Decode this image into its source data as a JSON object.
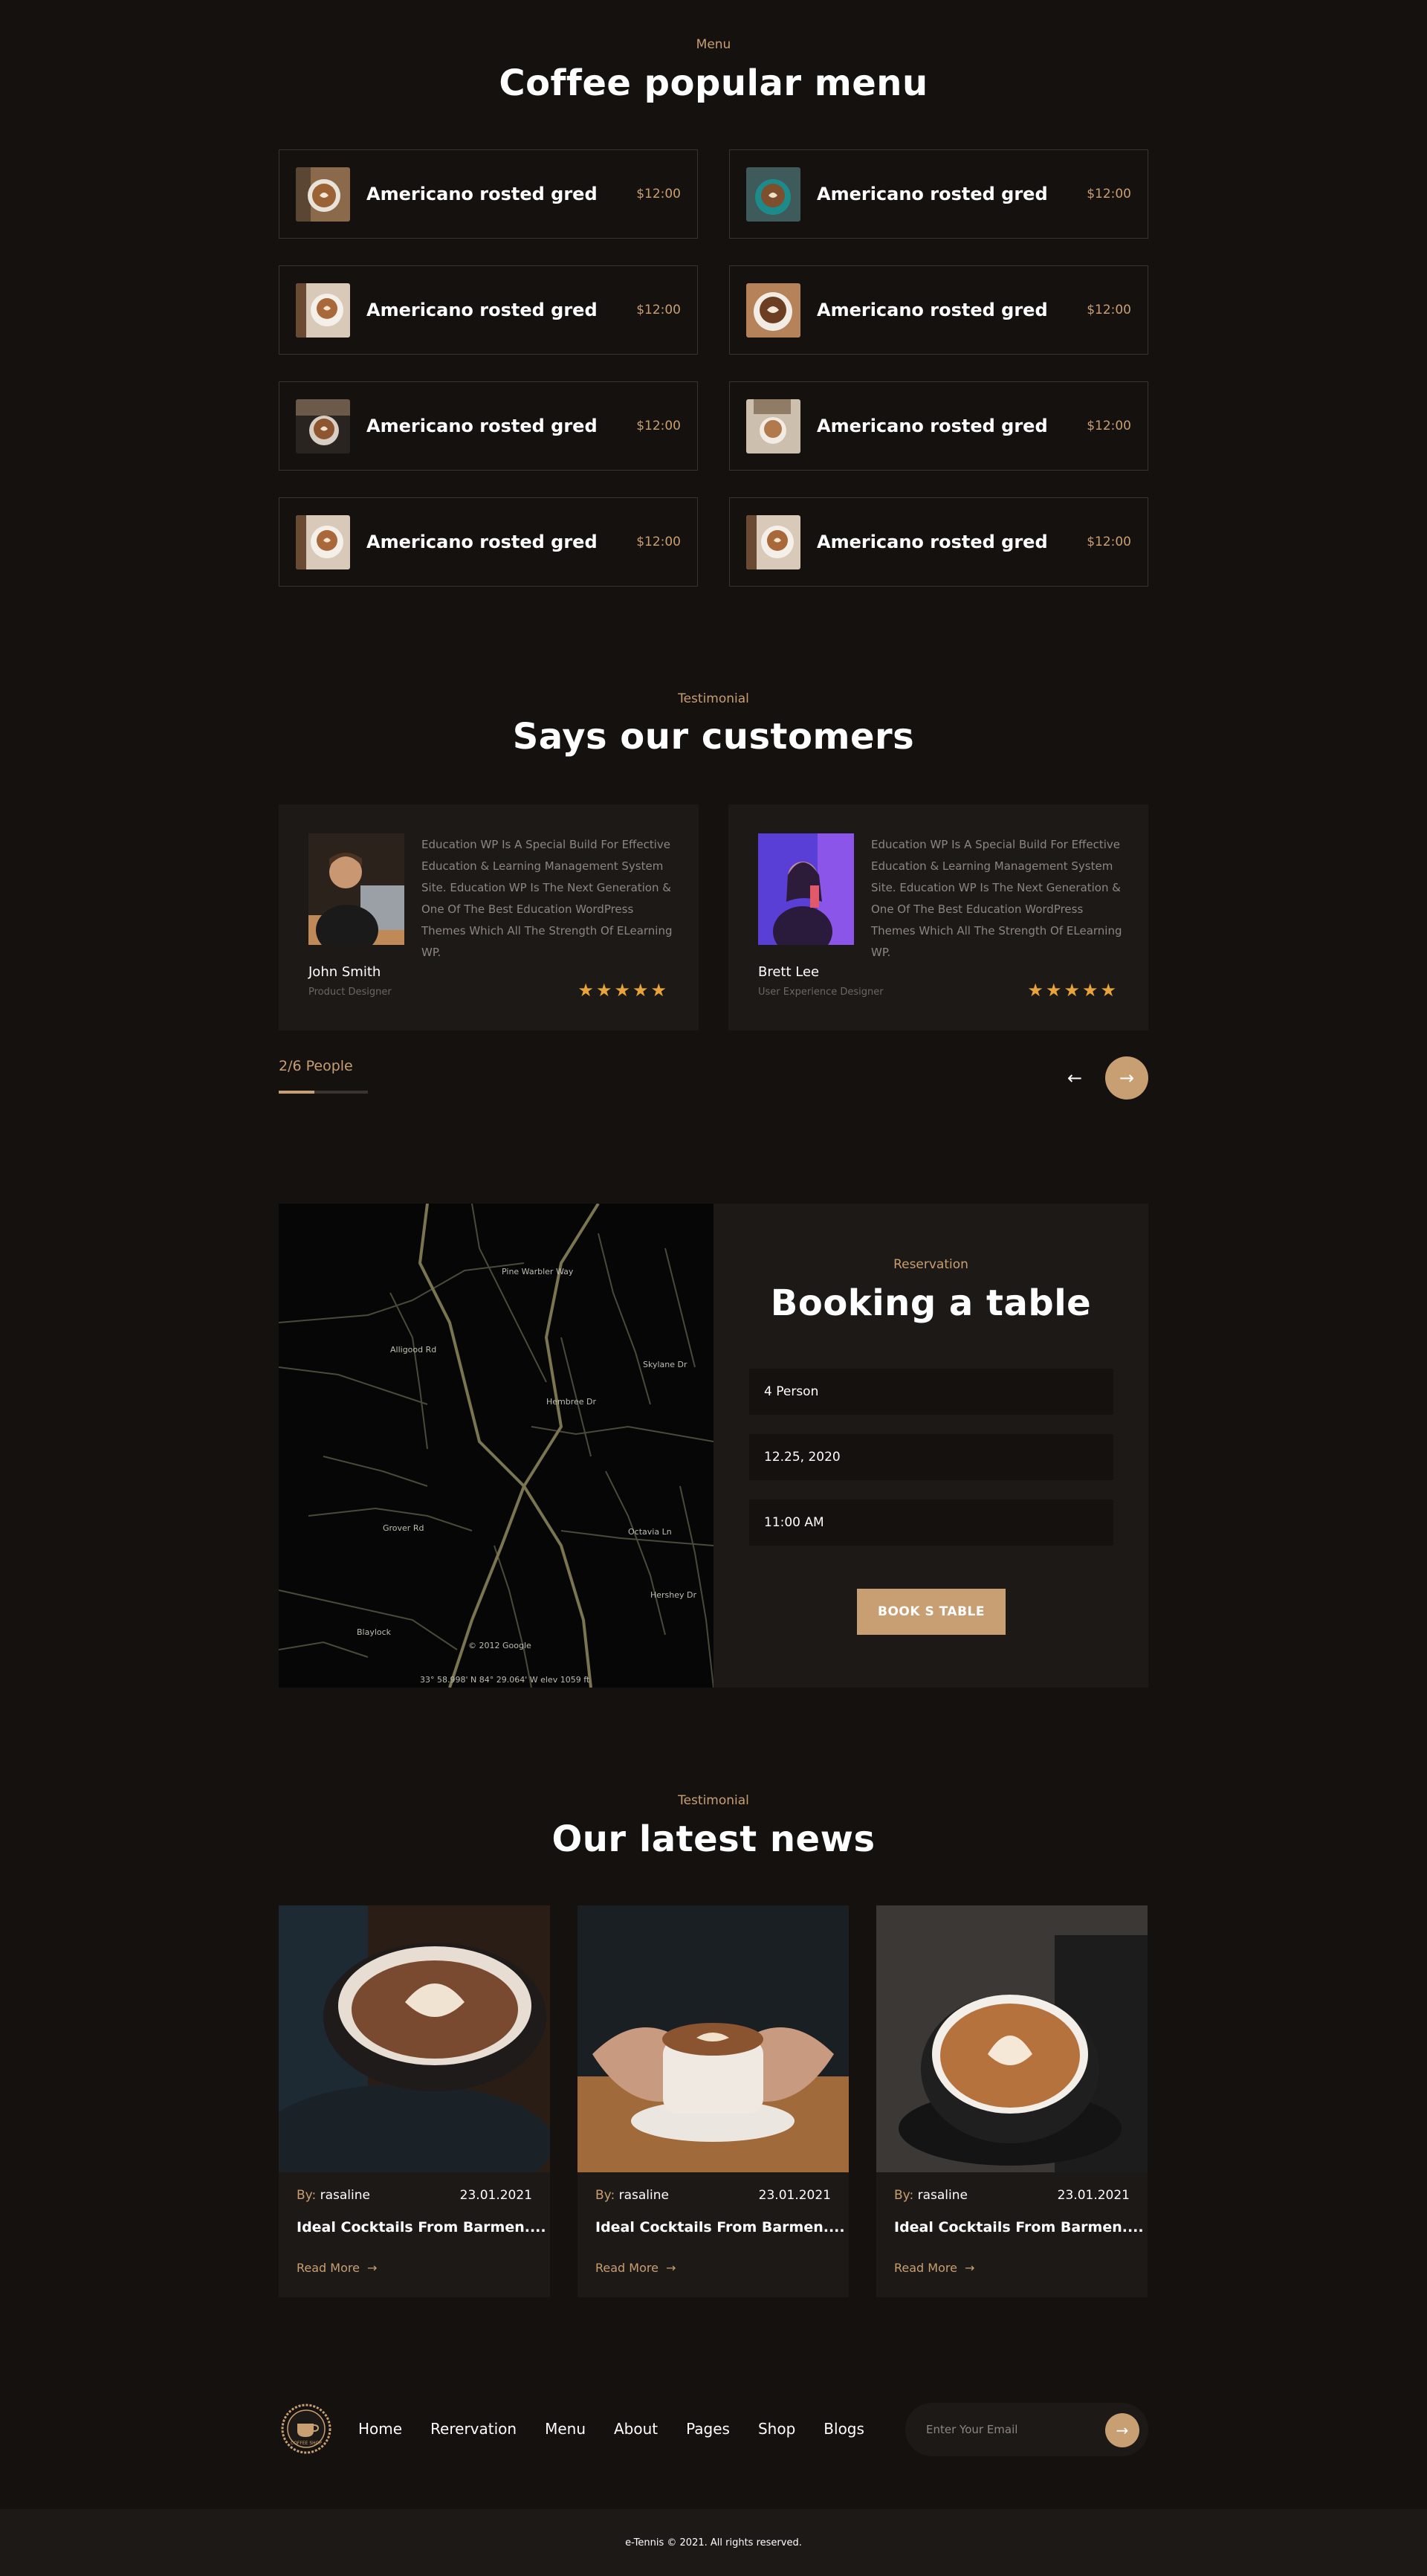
{
  "menu": {
    "eyebrow": "Menu",
    "title": "Coffee popular menu",
    "items": [
      {
        "name": "Americano rosted gred",
        "price": "$12:00"
      },
      {
        "name": "Americano rosted gred",
        "price": "$12:00"
      },
      {
        "name": "Americano rosted gred",
        "price": "$12:00"
      },
      {
        "name": "Americano rosted gred",
        "price": "$12:00"
      },
      {
        "name": "Americano rosted gred",
        "price": "$12:00"
      },
      {
        "name": "Americano rosted gred",
        "price": "$12:00"
      },
      {
        "name": "Americano rosted gred",
        "price": "$12:00"
      },
      {
        "name": "Americano rosted gred",
        "price": "$12:00"
      }
    ]
  },
  "testimonial": {
    "eyebrow": "Testimonial",
    "title": "Says our customers",
    "items": [
      {
        "text": "Education WP Is A Special Build For Effective Education & Learning Management System Site. Education WP Is The Next Generation & One Of The Best Education WordPress Themes Which All The Strength Of ELearning WP.",
        "name": "John Smith",
        "role": "Product Designer",
        "stars": "★★★★★"
      },
      {
        "text": "Education WP Is A Special Build For Effective Education & Learning Management System Site. Education WP Is The Next Generation & One Of The Best Education WordPress Themes Which All The Strength Of ELearning WP.",
        "name": "Brett Lee",
        "role": "User Experience Designer",
        "stars": "★★★★★"
      }
    ],
    "people_count": "2/6 People",
    "prev_icon": "←",
    "next_icon": "→"
  },
  "booking": {
    "eyebrow": "Reservation",
    "title": "Booking a table",
    "person": "4 Person",
    "date": "12.25, 2020",
    "time": "11:00 AM",
    "button": "BOOK S TABLE",
    "map_labels": {
      "street1": "Pine Warbler Way",
      "street2": "Alligood Rd",
      "street3": "Hembree Dr",
      "street4": "Skylane Dr",
      "street5": "Grover Rd",
      "street6": "Octavia Ln",
      "street7": "Blaylock",
      "street8": "Hershey Dr",
      "credit": "© 2012 Google",
      "coords": "33° 58.998' N  84° 29.064' W  elev 1059 ft"
    }
  },
  "news": {
    "eyebrow": "Testimonial",
    "title": "Our latest news",
    "items": [
      {
        "by_label": "By:",
        "author": "rasaline",
        "date": "23.01.2021",
        "title": "Ideal Cocktails From Barmen....",
        "more": "Read More",
        "arrow": "→"
      },
      {
        "by_label": "By:",
        "author": "rasaline",
        "date": "23.01.2021",
        "title": "Ideal Cocktails From Barmen....",
        "more": "Read More",
        "arrow": "→"
      },
      {
        "by_label": "By:",
        "author": "rasaline",
        "date": "23.01.2021",
        "title": "Ideal Cocktails From Barmen....",
        "more": "Read More",
        "arrow": "→"
      }
    ]
  },
  "footer": {
    "nav": [
      "Home",
      "Rerervation",
      "Menu",
      "About",
      "Pages",
      "Shop",
      "Blogs"
    ],
    "email_placeholder": "Enter Your Email",
    "submit_icon": "→",
    "copyright": "e-Tennis © 2021. All rights reserved.",
    "logo_text": "COFFEE SHOP"
  },
  "colors": {
    "background": "#15110f",
    "card": "#1d1916",
    "accent": "#c89f72",
    "stars": "#e8a33a"
  }
}
